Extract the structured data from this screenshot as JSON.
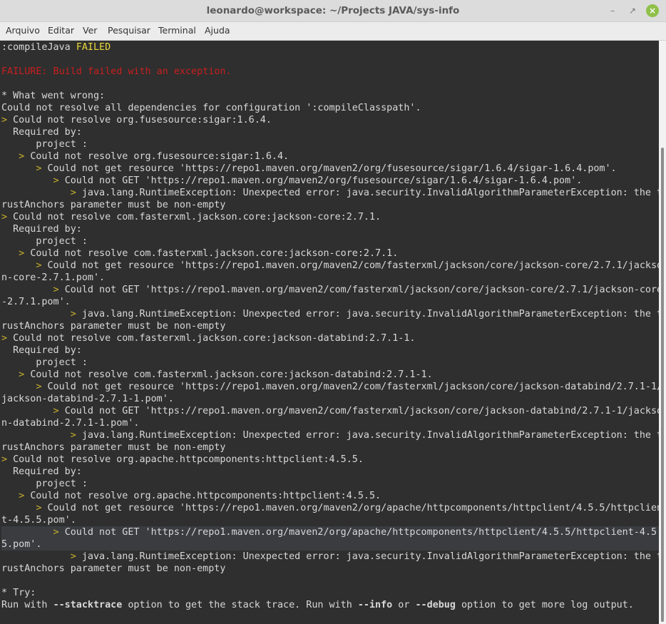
{
  "window": {
    "title": "leonardo@workspace: ~/Projects JAVA/sys-info"
  },
  "menu": [
    "Arquivo",
    "Editar",
    "Ver",
    "Pesquisar",
    "Terminal",
    "Ajuda"
  ],
  "terminal": {
    "lines": [
      {
        "s": [
          {
            "t": ":compileJava "
          },
          {
            "t": "FAILED",
            "c": "yellow"
          }
        ]
      },
      {
        "s": [
          {
            "t": ""
          }
        ]
      },
      {
        "s": [
          {
            "t": "FAILURE: Build failed with an exception.",
            "c": "red"
          }
        ]
      },
      {
        "s": [
          {
            "t": ""
          }
        ]
      },
      {
        "s": [
          {
            "t": "* What went wrong:"
          }
        ]
      },
      {
        "s": [
          {
            "t": "Could not resolve all dependencies for configuration ':compileClasspath'."
          }
        ]
      },
      {
        "s": [
          {
            "t": "> ",
            "c": "arrow"
          },
          {
            "t": "Could not resolve org.fusesource:sigar:1.6.4."
          }
        ]
      },
      {
        "s": [
          {
            "t": "  Required by:"
          }
        ]
      },
      {
        "s": [
          {
            "t": "      project :"
          }
        ]
      },
      {
        "s": [
          {
            "t": "   > ",
            "c": "arrow"
          },
          {
            "t": "Could not resolve org.fusesource:sigar:1.6.4."
          }
        ]
      },
      {
        "s": [
          {
            "t": "      > ",
            "c": "arrow"
          },
          {
            "t": "Could not get resource 'https://repo1.maven.org/maven2/org/fusesource/sigar/1.6.4/sigar-1.6.4.pom'."
          }
        ]
      },
      {
        "s": [
          {
            "t": "         > ",
            "c": "arrow"
          },
          {
            "t": "Could not GET 'https://repo1.maven.org/maven2/org/fusesource/sigar/1.6.4/sigar-1.6.4.pom'."
          }
        ]
      },
      {
        "s": [
          {
            "t": "            > ",
            "c": "arrow"
          },
          {
            "t": "java.lang.RuntimeException: Unexpected error: java.security.InvalidAlgorithmParameterException: the t"
          }
        ]
      },
      {
        "s": [
          {
            "t": "rustAnchors parameter must be non-empty"
          }
        ]
      },
      {
        "s": [
          {
            "t": "> ",
            "c": "arrow"
          },
          {
            "t": "Could not resolve com.fasterxml.jackson.core:jackson-core:2.7.1."
          }
        ]
      },
      {
        "s": [
          {
            "t": "  Required by:"
          }
        ]
      },
      {
        "s": [
          {
            "t": "      project :"
          }
        ]
      },
      {
        "s": [
          {
            "t": "   > ",
            "c": "arrow"
          },
          {
            "t": "Could not resolve com.fasterxml.jackson.core:jackson-core:2.7.1."
          }
        ]
      },
      {
        "s": [
          {
            "t": "      > ",
            "c": "arrow"
          },
          {
            "t": "Could not get resource 'https://repo1.maven.org/maven2/com/fasterxml/jackson/core/jackson-core/2.7.1/jackso"
          }
        ]
      },
      {
        "s": [
          {
            "t": "n-core-2.7.1.pom'."
          }
        ]
      },
      {
        "s": [
          {
            "t": "         > ",
            "c": "arrow"
          },
          {
            "t": "Could not GET 'https://repo1.maven.org/maven2/com/fasterxml/jackson/core/jackson-core/2.7.1/jackson-core"
          }
        ]
      },
      {
        "s": [
          {
            "t": "-2.7.1.pom'."
          }
        ]
      },
      {
        "s": [
          {
            "t": "            > ",
            "c": "arrow"
          },
          {
            "t": "java.lang.RuntimeException: Unexpected error: java.security.InvalidAlgorithmParameterException: the t"
          }
        ]
      },
      {
        "s": [
          {
            "t": "rustAnchors parameter must be non-empty"
          }
        ]
      },
      {
        "s": [
          {
            "t": "> ",
            "c": "arrow"
          },
          {
            "t": "Could not resolve com.fasterxml.jackson.core:jackson-databind:2.7.1-1."
          }
        ]
      },
      {
        "s": [
          {
            "t": "  Required by:"
          }
        ]
      },
      {
        "s": [
          {
            "t": "      project :"
          }
        ]
      },
      {
        "s": [
          {
            "t": "   > ",
            "c": "arrow"
          },
          {
            "t": "Could not resolve com.fasterxml.jackson.core:jackson-databind:2.7.1-1."
          }
        ]
      },
      {
        "s": [
          {
            "t": "      > ",
            "c": "arrow"
          },
          {
            "t": "Could not get resource 'https://repo1.maven.org/maven2/com/fasterxml/jackson/core/jackson-databind/2.7.1-1/"
          }
        ]
      },
      {
        "s": [
          {
            "t": "jackson-databind-2.7.1-1.pom'."
          }
        ]
      },
      {
        "s": [
          {
            "t": "         > ",
            "c": "arrow"
          },
          {
            "t": "Could not GET 'https://repo1.maven.org/maven2/com/fasterxml/jackson/core/jackson-databind/2.7.1-1/jackso"
          }
        ]
      },
      {
        "s": [
          {
            "t": "n-databind-2.7.1-1.pom'."
          }
        ]
      },
      {
        "s": [
          {
            "t": "            > ",
            "c": "arrow"
          },
          {
            "t": "java.lang.RuntimeException: Unexpected error: java.security.InvalidAlgorithmParameterException: the t"
          }
        ]
      },
      {
        "s": [
          {
            "t": "rustAnchors parameter must be non-empty"
          }
        ]
      },
      {
        "s": [
          {
            "t": "> ",
            "c": "arrow"
          },
          {
            "t": "Could not resolve org.apache.httpcomponents:httpclient:4.5.5."
          }
        ]
      },
      {
        "s": [
          {
            "t": "  Required by:"
          }
        ]
      },
      {
        "s": [
          {
            "t": "      project :"
          }
        ]
      },
      {
        "s": [
          {
            "t": "   > ",
            "c": "arrow"
          },
          {
            "t": "Could not resolve org.apache.httpcomponents:httpclient:4.5.5."
          }
        ]
      },
      {
        "s": [
          {
            "t": "      > ",
            "c": "arrow"
          },
          {
            "t": "Could not get resource 'https://repo1.maven.org/maven2/org/apache/httpcomponents/httpclient/4.5.5/httpclien"
          }
        ]
      },
      {
        "s": [
          {
            "t": "t-4.5.5.pom'."
          }
        ]
      },
      {
        "s": [
          {
            "t": "         > ",
            "c": "arrow"
          },
          {
            "t": "Could not GET 'https://repo1.maven.org/maven2/org/apache/httpcomponents/httpclient/4.5.5/httpclient-4.5."
          }
        ],
        "hl": true
      },
      {
        "s": [
          {
            "t": "5.pom'."
          }
        ],
        "hl": true
      },
      {
        "s": [
          {
            "t": "            > ",
            "c": "arrow"
          },
          {
            "t": "java.lang.RuntimeException: Unexpected error: java.security.InvalidAlgorithmParameterException: the t"
          }
        ]
      },
      {
        "s": [
          {
            "t": "rustAnchors parameter must be non-empty"
          }
        ]
      },
      {
        "s": [
          {
            "t": ""
          }
        ]
      },
      {
        "s": [
          {
            "t": "* Try:"
          }
        ]
      },
      {
        "s": [
          {
            "t": "Run with "
          },
          {
            "t": "--stacktrace",
            "c": "bold"
          },
          {
            "t": " option to get the stack trace. Run with "
          },
          {
            "t": "--info",
            "c": "bold"
          },
          {
            "t": " or "
          },
          {
            "t": "--debug",
            "c": "bold"
          },
          {
            "t": " option to get more log output."
          }
        ]
      }
    ]
  },
  "colors": {
    "background": "#2f2f2f",
    "text": "#d8d8d8",
    "failed": "#e8d83a",
    "failure": "#c81f1f",
    "arrow": "#c8b02c"
  },
  "icons": {
    "minimize": "minimize-icon",
    "maximize": "maximize-icon",
    "close": "close-icon"
  }
}
